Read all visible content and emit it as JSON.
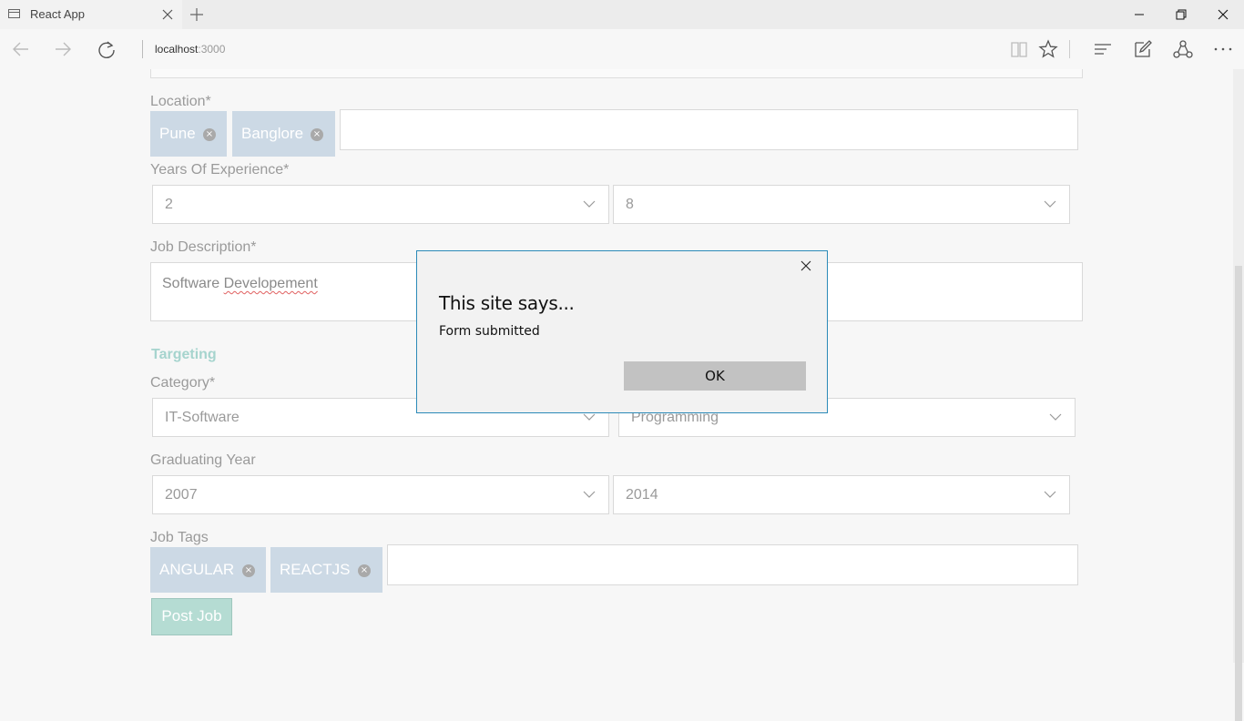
{
  "browser": {
    "tab_title": "React App",
    "address_host": "localhost",
    "address_port": ":3000"
  },
  "form": {
    "location": {
      "label": "Location*",
      "chips": [
        "Pune",
        "Banglore"
      ]
    },
    "experience": {
      "label": "Years Of Experience*",
      "min": "2",
      "max": "8"
    },
    "job_description": {
      "label": "Job Description*",
      "value_prefix": "Software ",
      "value_misspelled": "Developement"
    },
    "targeting_title": "Targeting",
    "category": {
      "label": "Category*",
      "main": "IT-Software",
      "sub": "Programming"
    },
    "graduating_year": {
      "label": "Graduating Year",
      "from": "2007",
      "to": "2014"
    },
    "job_tags": {
      "label": "Job Tags",
      "chips": [
        "ANGULAR",
        "REACTJS"
      ]
    },
    "submit_label": "Post Job"
  },
  "dialog": {
    "title": "This site says...",
    "message": "Form submitted",
    "ok_label": "OK"
  },
  "colors": {
    "chip_bg": "#ccd9e5",
    "accent_teal": "#a6d4ce",
    "dialog_border": "#2b8ab8"
  },
  "icons": {
    "chip_remove": "×"
  }
}
